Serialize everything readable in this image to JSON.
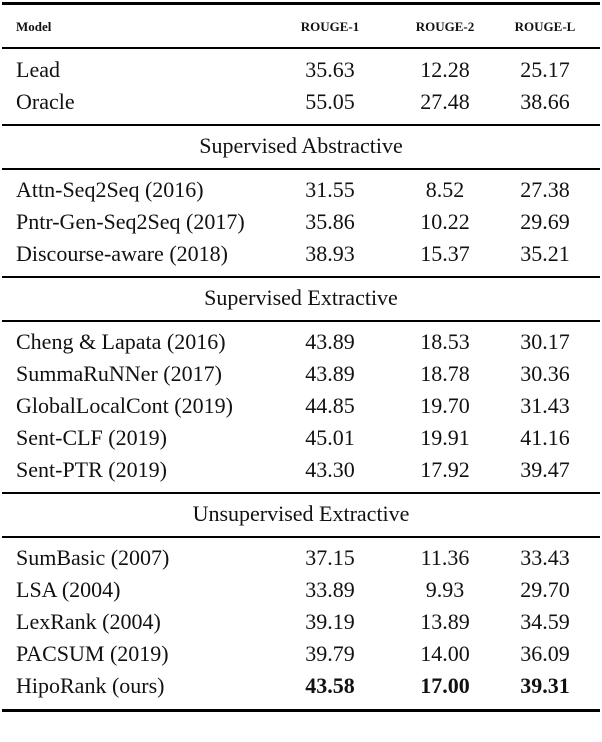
{
  "table": {
    "headers": [
      "Model",
      "ROUGE-1",
      "ROUGE-2",
      "ROUGE-L"
    ],
    "baselines": [
      {
        "model": "Lead",
        "r1": "35.63",
        "r2": "12.28",
        "rl": "25.17"
      },
      {
        "model": "Oracle",
        "r1": "55.05",
        "r2": "27.48",
        "rl": "38.66"
      }
    ],
    "sections": [
      {
        "title": "Supervised Abstractive",
        "rows": [
          {
            "model": "Attn-Seq2Seq (2016)",
            "r1": "31.55",
            "r2": "8.52",
            "rl": "27.38"
          },
          {
            "model": "Pntr-Gen-Seq2Seq (2017)",
            "r1": "35.86",
            "r2": "10.22",
            "rl": "29.69"
          },
          {
            "model": "Discourse-aware (2018)",
            "r1": "38.93",
            "r2": "15.37",
            "rl": "35.21"
          }
        ]
      },
      {
        "title": "Supervised Extractive",
        "rows": [
          {
            "model": "Cheng & Lapata (2016)",
            "r1": "43.89",
            "r2": "18.53",
            "rl": "30.17"
          },
          {
            "model": "SummaRuNNer (2017)",
            "r1": "43.89",
            "r2": "18.78",
            "rl": "30.36"
          },
          {
            "model": "GlobalLocalCont (2019)",
            "r1": "44.85",
            "r2": "19.70",
            "rl": "31.43"
          },
          {
            "model": "Sent-CLF (2019)",
            "r1": "45.01",
            "r2": "19.91",
            "rl": "41.16"
          },
          {
            "model": "Sent-PTR (2019)",
            "r1": "43.30",
            "r2": "17.92",
            "rl": "39.47"
          }
        ]
      },
      {
        "title": "Unsupervised Extractive",
        "rows": [
          {
            "model": "SumBasic (2007)",
            "r1": "37.15",
            "r2": "11.36",
            "rl": "33.43"
          },
          {
            "model": "LSA (2004)",
            "r1": "33.89",
            "r2": "9.93",
            "rl": "29.70"
          },
          {
            "model": "LexRank (2004)",
            "r1": "39.19",
            "r2": "13.89",
            "rl": "34.59"
          },
          {
            "model": "PACSUM (2019)",
            "r1": "39.79",
            "r2": "14.00",
            "rl": "36.09"
          },
          {
            "model": "HipoRank (ours)",
            "r1": "43.58",
            "r2": "17.00",
            "rl": "39.31",
            "bold": true
          }
        ]
      }
    ]
  }
}
